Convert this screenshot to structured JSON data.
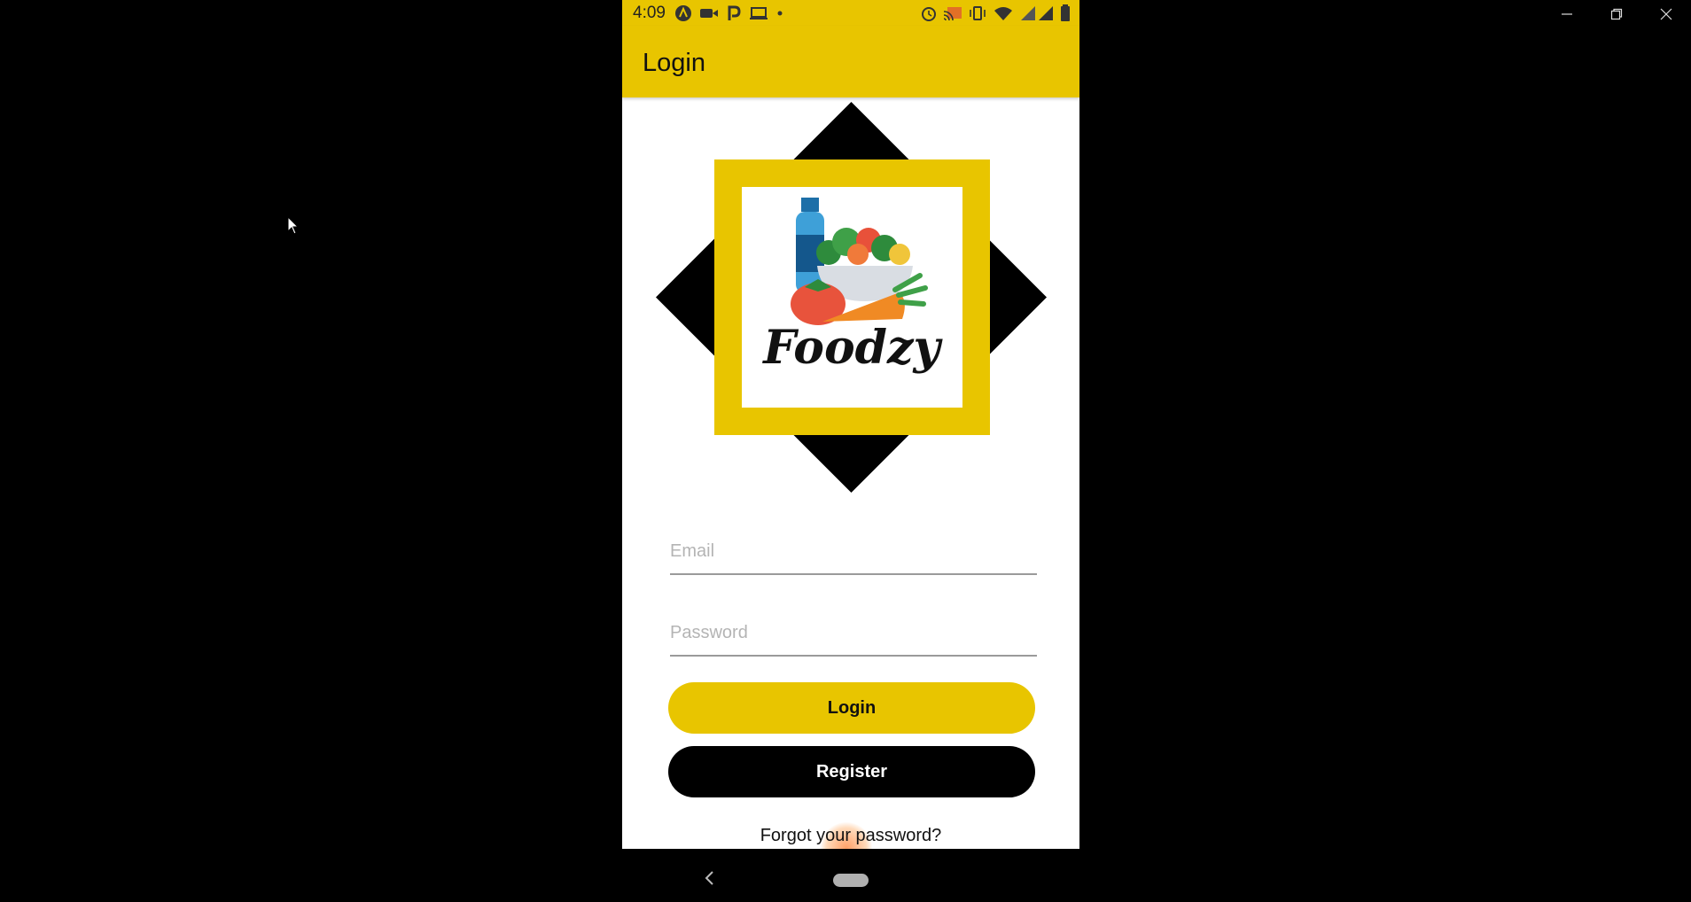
{
  "status_bar": {
    "time": "4:09",
    "left_icons": [
      "a-badge-icon",
      "video-camera-icon",
      "p-badge-icon",
      "laptop-icon",
      "dot-icon"
    ],
    "right_icons": [
      "alarm-icon",
      "cast-icon",
      "vibrate-icon",
      "wifi-icon",
      "signal-icon",
      "battery-icon"
    ]
  },
  "app_bar": {
    "title": "Login"
  },
  "logo": {
    "wordmark": "Foodzy"
  },
  "form": {
    "email_placeholder": "Email",
    "password_placeholder": "Password",
    "login_label": "Login",
    "register_label": "Register",
    "forgot_label": "Forgot your password?"
  },
  "colors": {
    "accent": "#e8c500",
    "dark": "#000000",
    "background": "#ffffff"
  }
}
